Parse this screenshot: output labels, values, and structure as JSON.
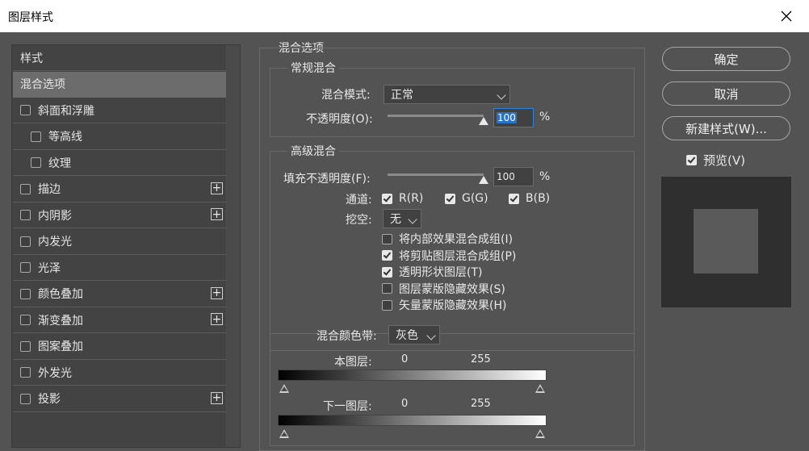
{
  "window": {
    "title": "图层样式"
  },
  "sidebar": {
    "items": [
      {
        "label": "样式",
        "checkbox": false,
        "plus": false,
        "indent": 0
      },
      {
        "label": "混合选项",
        "checkbox": false,
        "plus": false,
        "indent": 0,
        "selected": true
      },
      {
        "label": "斜面和浮雕",
        "checkbox": true,
        "plus": false,
        "indent": 0
      },
      {
        "label": "等高线",
        "checkbox": true,
        "plus": false,
        "indent": 1
      },
      {
        "label": "纹理",
        "checkbox": true,
        "plus": false,
        "indent": 1
      },
      {
        "label": "描边",
        "checkbox": true,
        "plus": true,
        "indent": 0
      },
      {
        "label": "内阴影",
        "checkbox": true,
        "plus": true,
        "indent": 0
      },
      {
        "label": "内发光",
        "checkbox": true,
        "plus": false,
        "indent": 0
      },
      {
        "label": "光泽",
        "checkbox": true,
        "plus": false,
        "indent": 0
      },
      {
        "label": "颜色叠加",
        "checkbox": true,
        "plus": true,
        "indent": 0
      },
      {
        "label": "渐变叠加",
        "checkbox": true,
        "plus": true,
        "indent": 0
      },
      {
        "label": "图案叠加",
        "checkbox": true,
        "plus": false,
        "indent": 0
      },
      {
        "label": "外发光",
        "checkbox": true,
        "plus": false,
        "indent": 0
      },
      {
        "label": "投影",
        "checkbox": true,
        "plus": true,
        "indent": 0
      }
    ]
  },
  "blend": {
    "section_title": "混合选项",
    "general": {
      "title": "常规混合",
      "mode_label": "混合模式:",
      "mode_value": "正常",
      "opacity_label": "不透明度(O):",
      "opacity_value": "100",
      "unit": "%"
    },
    "advanced": {
      "title": "高级混合",
      "fill_label": "填充不透明度(F):",
      "fill_value": "100",
      "unit": "%",
      "channels_label": "通道:",
      "channels": [
        {
          "label": "R(R)",
          "checked": true
        },
        {
          "label": "G(G)",
          "checked": true
        },
        {
          "label": "B(B)",
          "checked": true
        }
      ],
      "knockout_label": "挖空:",
      "knockout_value": "无",
      "options": [
        {
          "label": "将内部效果混合成组(I)",
          "checked": false
        },
        {
          "label": "将剪贴图层混合成组(P)",
          "checked": true
        },
        {
          "label": "透明形状图层(T)",
          "checked": true
        },
        {
          "label": "图层蒙版隐藏效果(S)",
          "checked": false
        },
        {
          "label": "矢量蒙版隐藏效果(H)",
          "checked": false
        }
      ]
    },
    "blend_if": {
      "label": "混合颜色带:",
      "value": "灰色",
      "this_layer": {
        "label": "本图层:",
        "low": "0",
        "high": "255"
      },
      "underlying": {
        "label": "下一图层:",
        "low": "0",
        "high": "255"
      }
    }
  },
  "buttons": {
    "ok": "确定",
    "cancel": "取消",
    "new_style": "新建样式(W)...",
    "preview": {
      "label": "预览(V)",
      "checked": true
    }
  },
  "colors": {
    "panel": "#535353",
    "sidebar": "#434343",
    "selection": "#6c6c6c",
    "highlight": "#2a71c9"
  }
}
